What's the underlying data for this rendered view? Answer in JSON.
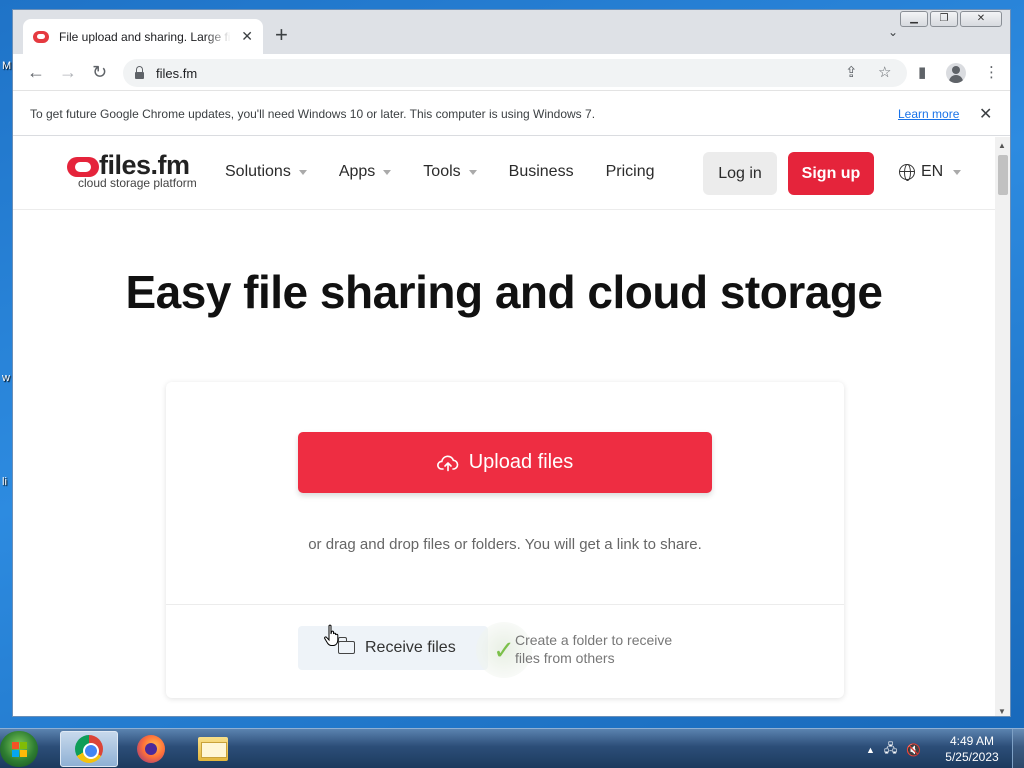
{
  "desktop": {
    "fragments": [
      "M",
      "w",
      "li"
    ]
  },
  "browser": {
    "tab": {
      "title": "File upload and sharing. Large files",
      "close": "✕"
    },
    "new_tab": "+",
    "tab_search": "⌄",
    "window_controls": {
      "minimize": "▁",
      "restore": "❐",
      "close": "✕"
    },
    "nav": {
      "back": "←",
      "forward": "→",
      "reload": "↻"
    },
    "url": "files.fm",
    "icons": {
      "share": "⇪",
      "bookmark": "☆",
      "side_panel": "▮",
      "menu": "⋮"
    },
    "infobar": {
      "message": "To get future Google Chrome updates, you'll need Windows 10 or later. This computer is using Windows 7.",
      "link": "Learn more",
      "close": "✕"
    },
    "scroll": {
      "up": "▲",
      "down": "▼"
    }
  },
  "site": {
    "logo": {
      "wordmark": "files.fm",
      "tagline": "cloud storage platform"
    },
    "nav": [
      {
        "label": "Solutions",
        "has_menu": true
      },
      {
        "label": "Apps",
        "has_menu": true
      },
      {
        "label": "Tools",
        "has_menu": true
      },
      {
        "label": "Business",
        "has_menu": false
      },
      {
        "label": "Pricing",
        "has_menu": false
      }
    ],
    "login": "Log in",
    "signup": "Sign up",
    "language": "EN",
    "hero_title": "Easy file sharing and cloud storage",
    "upload": {
      "button": "Upload files",
      "drag_text": "or drag and drop files or folders. You will get a link to share."
    },
    "receive": {
      "button": "Receive files",
      "check": "✓",
      "help": "Create a folder to receive files from others"
    }
  },
  "taskbar": {
    "apps": [
      "chrome",
      "firefox",
      "file-explorer"
    ],
    "tray": {
      "arrow": "▲",
      "network": "🖧",
      "volume": "🔇"
    },
    "clock": {
      "time": "4:49 AM",
      "date": "5/25/2023"
    }
  },
  "colors": {
    "brand_red": "#e5243b",
    "upload_red": "#ee2d42",
    "link_blue": "#1a73e8"
  }
}
